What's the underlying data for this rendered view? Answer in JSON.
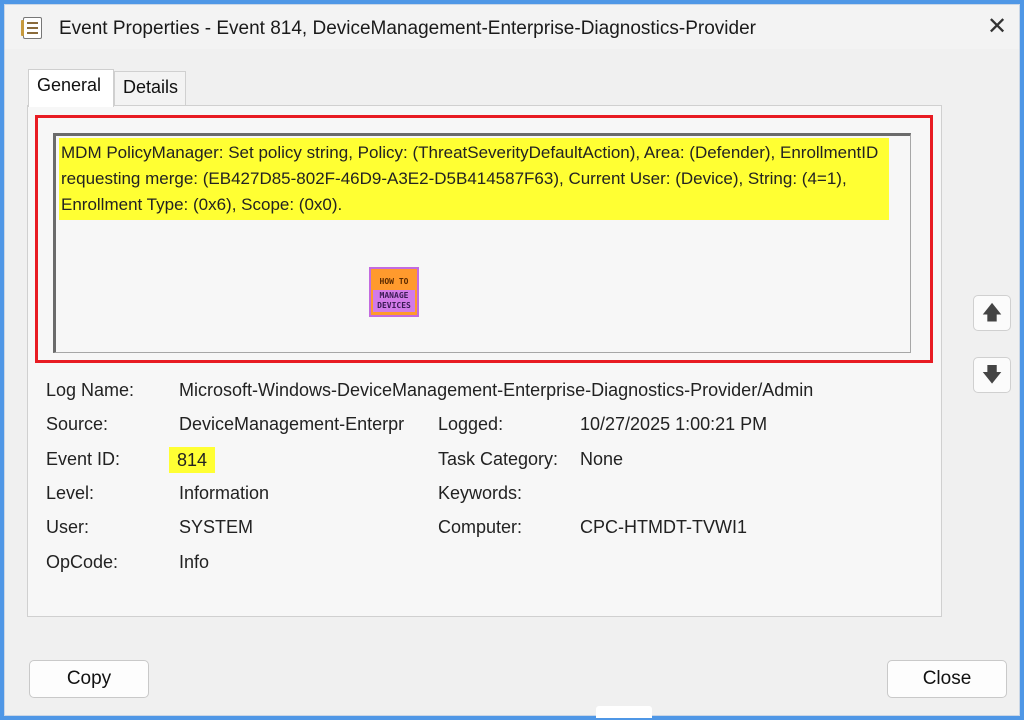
{
  "window": {
    "title": "Event Properties - Event 814, DeviceManagement-Enterprise-Diagnostics-Provider",
    "close_glyph": "✕"
  },
  "tabs": [
    {
      "label": "General",
      "active": true
    },
    {
      "label": "Details",
      "active": false
    }
  ],
  "message": {
    "text": "MDM PolicyManager: Set policy string, Policy: (ThreatSeverityDefaultAction), Area: (Defender), EnrollmentID requesting merge: (EB427D85-802F-46D9-A3E2-D5B414587F63), Current User: (Device), String: (4=1), Enrollment Type: (0x6), Scope: (0x0).",
    "highlight_color": "#ffff33"
  },
  "logo": {
    "line1": "HOW TO",
    "line2": "MANAGE DEVICES"
  },
  "nav": {
    "up_glyph": "🡅",
    "down_glyph": "🡇"
  },
  "properties": {
    "log_name": {
      "label": "Log Name:",
      "value": "Microsoft-Windows-DeviceManagement-Enterprise-Diagnostics-Provider/Admin"
    },
    "source": {
      "label": "Source:",
      "value": "DeviceManagement-Enterpr"
    },
    "logged": {
      "label": "Logged:",
      "value": "10/27/2025 1:00:21 PM"
    },
    "event_id": {
      "label": "Event ID:",
      "value": "814"
    },
    "task_category": {
      "label": "Task Category:",
      "value": "None"
    },
    "level": {
      "label": "Level:",
      "value": "Information"
    },
    "keywords": {
      "label": "Keywords:",
      "value": ""
    },
    "user": {
      "label": "User:",
      "value": "SYSTEM"
    },
    "computer": {
      "label": "Computer:",
      "value": "CPC-HTMDT-TVWI1"
    },
    "opcode": {
      "label": "OpCode:",
      "value": "Info"
    }
  },
  "buttons": {
    "copy": "Copy",
    "close": "Close"
  },
  "colors": {
    "annotation_frame": "#e81c23",
    "background": "#4f97e6"
  }
}
